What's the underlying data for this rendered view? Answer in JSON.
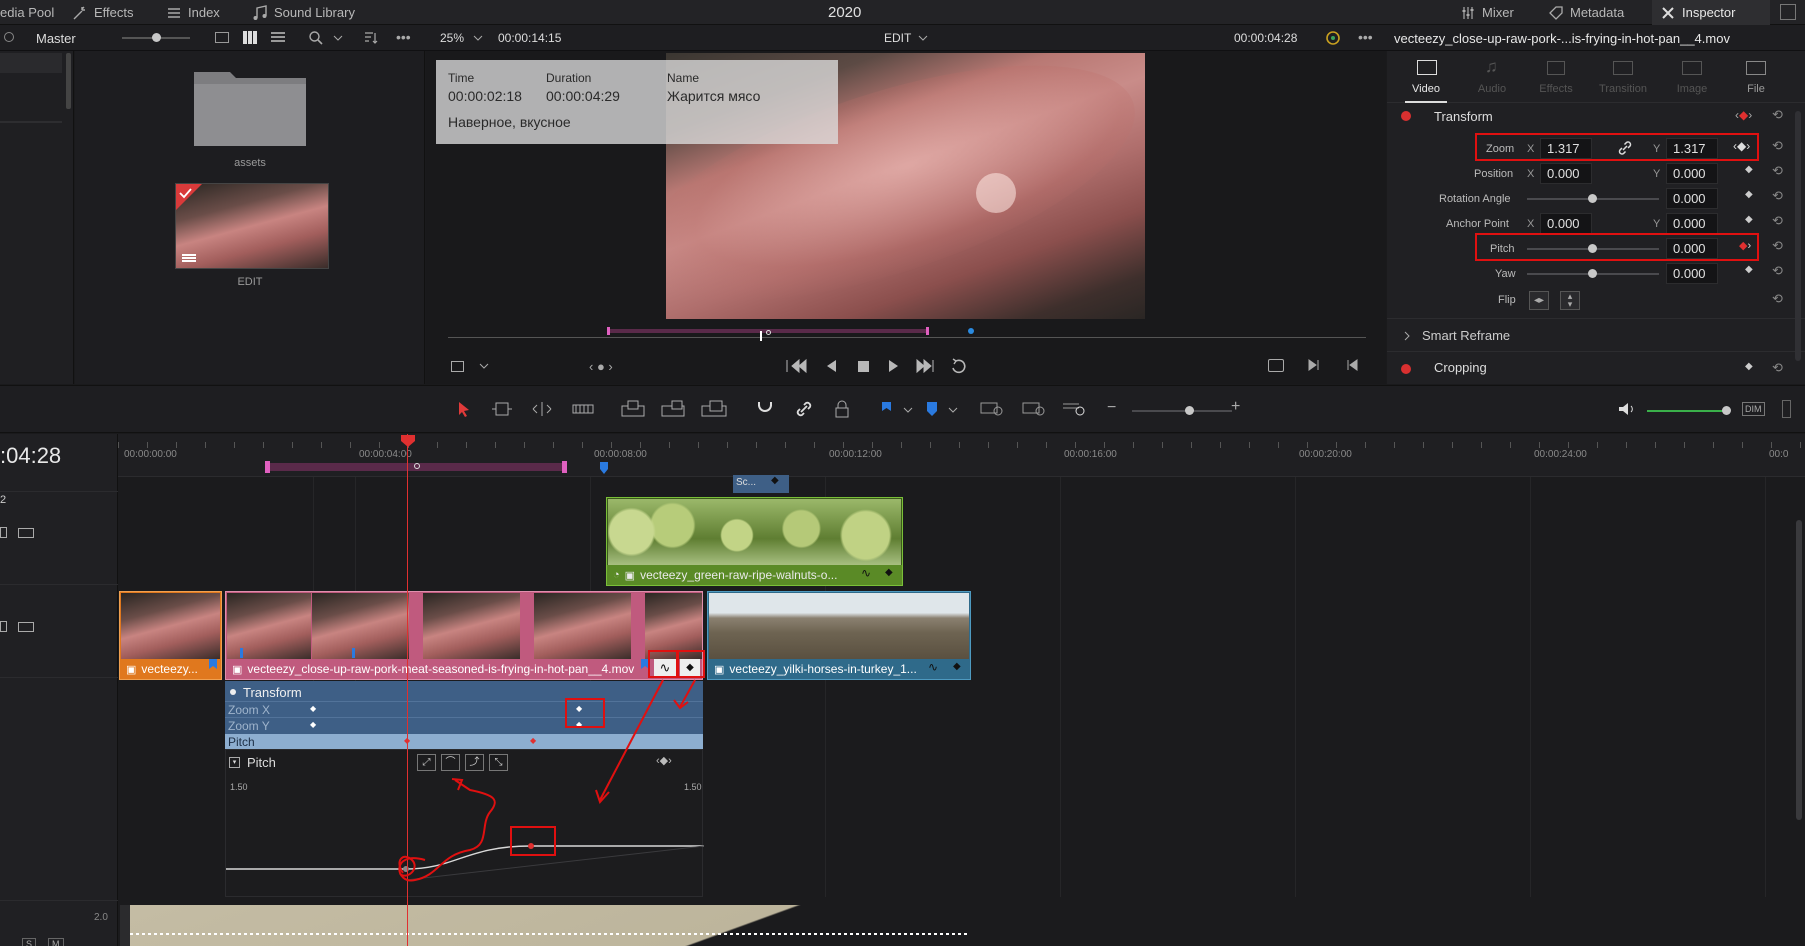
{
  "topbar": {
    "media_pool": "edia Pool",
    "effects": "Effects",
    "index": "Index",
    "sound_library": "Sound Library",
    "project": "2020",
    "mixer": "Mixer",
    "metadata": "Metadata",
    "inspector": "Inspector"
  },
  "bar2": {
    "master": "Master",
    "zoom": "25%",
    "timecode": "00:00:14:15",
    "mode": "EDIT",
    "viewer_tc": "00:00:04:28",
    "clip_name": "vecteezy_close-up-raw-pork-...is-frying-in-hot-pan__4.mov"
  },
  "media": {
    "folder_label": "assets",
    "timeline_label": "EDIT"
  },
  "overlay": {
    "time_h": "Time",
    "time_v": "00:00:02:18",
    "dur_h": "Duration",
    "dur_v": "00:00:04:29",
    "name_h": "Name",
    "name_v": "Жарится мясо",
    "note": "Наверное, вкусное"
  },
  "inspector": {
    "tabs": [
      "Video",
      "Audio",
      "Effects",
      "Transition",
      "Image",
      "File"
    ],
    "transform": "Transform",
    "zoom_label": "Zoom",
    "x": "X",
    "y": "Y",
    "zoom_x": "1.317",
    "zoom_y": "1.317",
    "position_label": "Position",
    "pos_x": "0.000",
    "pos_y": "0.000",
    "rotation_label": "Rotation Angle",
    "rotation": "0.000",
    "anchor_label": "Anchor Point",
    "anchor_x": "0.000",
    "anchor_y": "0.000",
    "pitch_label": "Pitch",
    "pitch": "0.000",
    "yaw_label": "Yaw",
    "yaw": "0.000",
    "flip_label": "Flip",
    "smart_reframe": "Smart Reframe",
    "cropping": "Cropping"
  },
  "timeline": {
    "timecode": ":04:28",
    "ruler": [
      "00:00:00:00",
      "00:00:04:00",
      "00:00:08:00",
      "00:00:12:00",
      "00:00:16:00",
      "00:00:20:00",
      "00:00:24:00",
      "00:0"
    ],
    "track_num": "2",
    "sc_label": "Sc...",
    "walnut_clip": "vecteezy_green-raw-ripe-walnuts-o...",
    "pork_clip_a": "vecteezy...",
    "pork_clip_b": "vecteezy_close-up-raw-pork-meat-seasoned-is-frying-in-hot-pan__4.mov",
    "horse_clip": "vecteezy_yilki-horses-in-turkey_1...",
    "kf_transform": "Transform",
    "kf_zoomx": "Zoom X",
    "kf_zoomy": "Zoom Y",
    "kf_pitch": "Pitch",
    "curve_title": "Pitch",
    "curve_max_l": "1.50",
    "curve_max_r": "1.50",
    "audio_level": "2.0",
    "audio_s": "S",
    "audio_m": "M",
    "dim": "DIM"
  },
  "colors": {
    "accent_red": "#e01010",
    "orange_clip": "#e0781e",
    "pink_clip": "#c05a7e",
    "green_clip": "#5a8a26",
    "teal_clip": "#2f6a8a",
    "playhead": "#e03030"
  }
}
